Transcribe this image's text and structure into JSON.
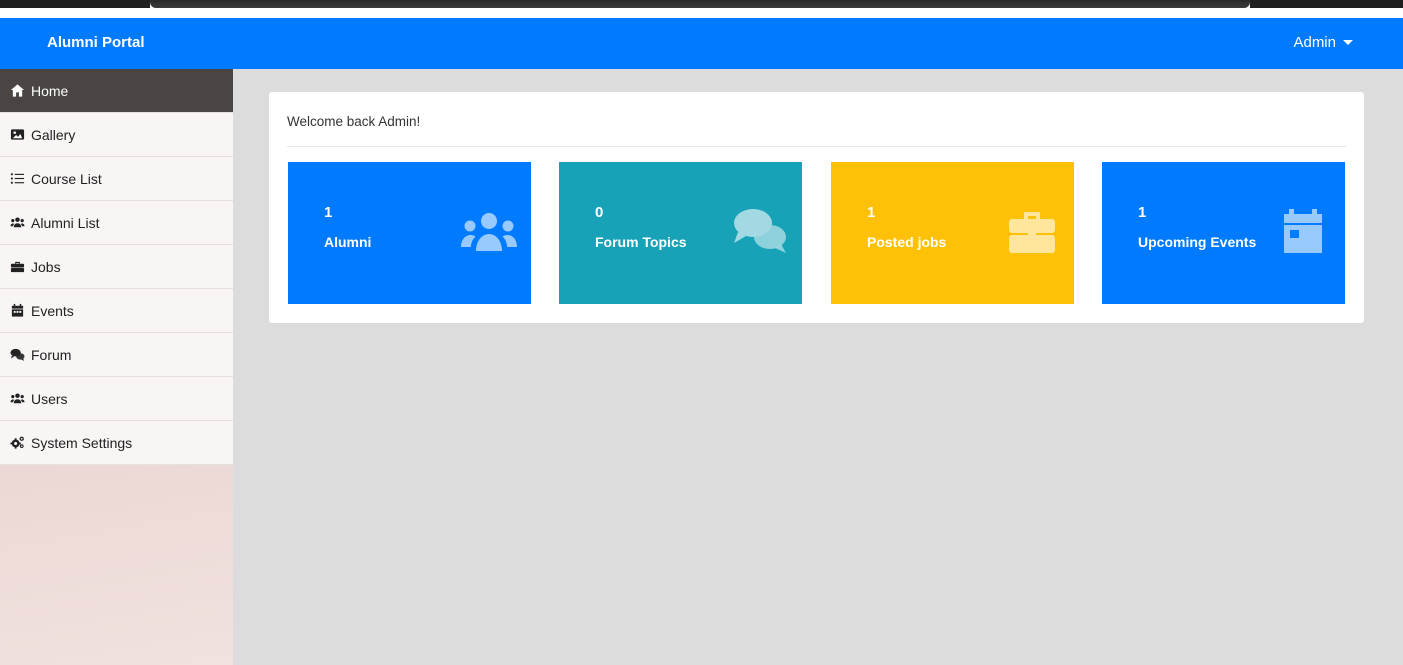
{
  "brand": "Alumni Portal",
  "user_menu": {
    "label": "Admin"
  },
  "sidebar": {
    "items": [
      {
        "label": "Home",
        "icon": "home-icon",
        "active": true
      },
      {
        "label": "Gallery",
        "icon": "image-icon"
      },
      {
        "label": "Course List",
        "icon": "list-icon"
      },
      {
        "label": "Alumni List",
        "icon": "users-icon"
      },
      {
        "label": "Jobs",
        "icon": "briefcase-icon"
      },
      {
        "label": "Events",
        "icon": "calendar-icon"
      },
      {
        "label": "Forum",
        "icon": "comments-icon"
      },
      {
        "label": "Users",
        "icon": "users-icon"
      },
      {
        "label": "System Settings",
        "icon": "cogs-icon"
      }
    ]
  },
  "main": {
    "welcome": "Welcome back Admin!",
    "stats": [
      {
        "value": "1",
        "label": "Alumni",
        "color": "#007bff",
        "icon": "users-icon"
      },
      {
        "value": "0",
        "label": "Forum Topics",
        "color": "#17a2b8",
        "icon": "comments-icon"
      },
      {
        "value": "1",
        "label": "Posted jobs",
        "color": "#ffc107",
        "icon": "briefcase-icon"
      },
      {
        "value": "1",
        "label": "Upcoming Events",
        "color": "#007bff",
        "icon": "calendar-icon"
      }
    ]
  },
  "colors": {
    "navbar": "#007bff",
    "sidebar_active": "#4a4442",
    "background": "#dcdcdc"
  }
}
